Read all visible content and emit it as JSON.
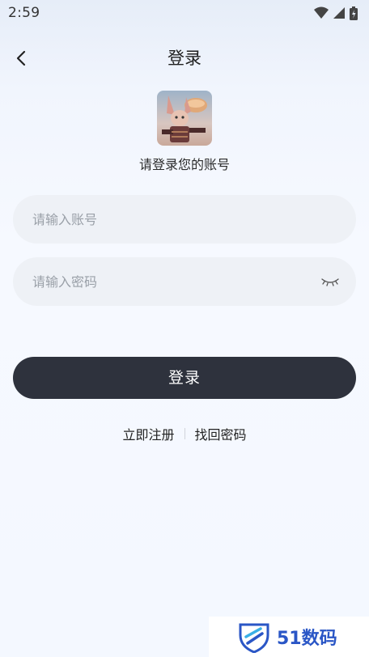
{
  "status_bar": {
    "time": "2:59",
    "icons": [
      "wifi-icon",
      "signal-icon",
      "battery-icon"
    ]
  },
  "nav": {
    "title": "登录",
    "back_icon": "chevron-left-icon"
  },
  "avatar": {
    "alt": "avatar"
  },
  "subtitle": "请登录您的账号",
  "form": {
    "account_placeholder": "请输入账号",
    "account_value": "",
    "password_placeholder": "请输入密码",
    "password_value": "",
    "password_toggle_icon": "eye-closed-icon"
  },
  "login_button": "登录",
  "links": {
    "register": "立即注册",
    "forgot": "找回密码"
  },
  "watermark": {
    "text": "51数码",
    "icon": "shield-logo-icon"
  },
  "colors": {
    "button_bg": "#2e323d",
    "field_bg": "#eef1f6",
    "watermark": "#2a56c6"
  }
}
